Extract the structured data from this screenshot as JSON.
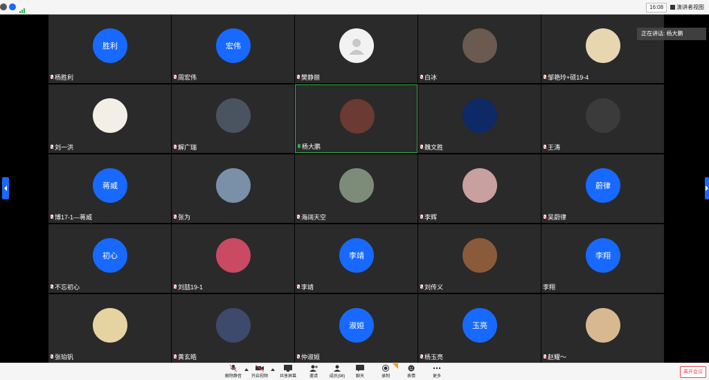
{
  "topbar": {
    "clock": "16:08",
    "speaker_view_label": "演讲者视图"
  },
  "speaking_indicator": "正在讲话: 杨大鹏",
  "participants": [
    {
      "name": "杨胜利",
      "avatar_text": "胜利",
      "avatar_type": "text",
      "mic": "muted"
    },
    {
      "name": "周宏伟",
      "avatar_text": "宏伟",
      "avatar_type": "text",
      "mic": "muted"
    },
    {
      "name": "樊静丽",
      "avatar_type": "image",
      "avatar_color": "#f2f2f2",
      "mic": "muted"
    },
    {
      "name": "白冰",
      "avatar_type": "image",
      "avatar_color": "#6a5a50",
      "mic": "muted"
    },
    {
      "name": "邹艳玲+硕19-4",
      "avatar_type": "image",
      "avatar_color": "#e8d6b0",
      "mic": "muted"
    },
    {
      "name": "刘一洪",
      "avatar_type": "image",
      "avatar_color": "#f3efe6",
      "mic": "muted"
    },
    {
      "name": "解广瑞",
      "avatar_type": "image",
      "avatar_color": "#4a5360",
      "mic": "muted"
    },
    {
      "name": "杨大鹏",
      "avatar_type": "image",
      "avatar_color": "#6b3a32",
      "mic": "on",
      "active": true
    },
    {
      "name": "魏文胜",
      "avatar_type": "image",
      "avatar_color": "#0d2a66",
      "mic": "muted"
    },
    {
      "name": "王涛",
      "avatar_type": "image",
      "avatar_color": "#3b3b3b",
      "mic": "muted"
    },
    {
      "name": "博17-1—蒋威",
      "avatar_text": "蒋威",
      "avatar_type": "text",
      "mic": "muted"
    },
    {
      "name": "张为",
      "avatar_type": "image",
      "avatar_color": "#7a8fa8",
      "mic": "muted"
    },
    {
      "name": "海阔天空",
      "avatar_type": "image",
      "avatar_color": "#7c8c78",
      "mic": "muted"
    },
    {
      "name": "李辉",
      "avatar_type": "image",
      "avatar_color": "#c8a0a0",
      "mic": "muted"
    },
    {
      "name": "吴蔚律",
      "avatar_text": "蔚律",
      "avatar_type": "text",
      "mic": "muted"
    },
    {
      "name": "不忘初心",
      "avatar_text": "初心",
      "avatar_type": "text",
      "mic": "muted"
    },
    {
      "name": "刘喆19-1",
      "avatar_type": "image",
      "avatar_color": "#c94a62",
      "mic": "muted"
    },
    {
      "name": "李靖",
      "avatar_text": "李靖",
      "avatar_type": "text",
      "mic": "muted"
    },
    {
      "name": "刘传义",
      "avatar_type": "image",
      "avatar_color": "#8a5a3a",
      "mic": "muted"
    },
    {
      "name": "李翔",
      "avatar_text": "李翔",
      "avatar_type": "text",
      "mic": "none"
    },
    {
      "name": "张珀钒",
      "avatar_type": "image",
      "avatar_color": "#e6d3a2",
      "mic": "muted"
    },
    {
      "name": "黄玄皓",
      "avatar_type": "image",
      "avatar_color": "#3e4a6b",
      "mic": "muted"
    },
    {
      "name": "仲淑姮",
      "avatar_text": "淑姮",
      "avatar_type": "text",
      "mic": "muted"
    },
    {
      "name": "杨玉亮",
      "avatar_text": "玉亮",
      "avatar_type": "text",
      "mic": "muted"
    },
    {
      "name": "赵耀～",
      "avatar_type": "image",
      "avatar_color": "#d8b890",
      "mic": "muted"
    }
  ],
  "toolbar": {
    "unmute": "解除静音",
    "start_video": "开启视频",
    "share_screen": "共享屏幕",
    "invite": "邀请",
    "members": "成员(98)",
    "chat": "聊天",
    "record": "录制",
    "reactions": "表情",
    "more": "更多",
    "leave": "离开会议"
  },
  "colors": {
    "accent": "#1769ff",
    "active_border": "#2fb34a",
    "danger": "#e5484d",
    "tile_bg": "#2a2a2a"
  }
}
